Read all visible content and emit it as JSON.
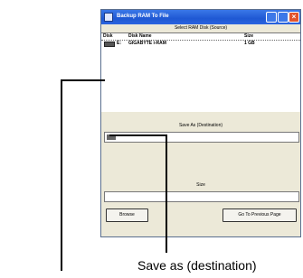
{
  "window": {
    "title": "Backup RAM To File",
    "subheader": "Select RAM Disk (Source)"
  },
  "list": {
    "columns": [
      "Disk",
      "Disk Name",
      "Size"
    ],
    "rows": [
      {
        "disk": "E:",
        "name": "GIGABYTE i-RAM",
        "size": "1 GB"
      }
    ]
  },
  "save_section": {
    "label": "Save As (Destination)",
    "value": ""
  },
  "size_section": {
    "label": "Size",
    "value": ""
  },
  "buttons": {
    "browse": "Browse",
    "previous": "Go To Previous Page"
  },
  "callout": {
    "label": "Save as (destination)"
  }
}
